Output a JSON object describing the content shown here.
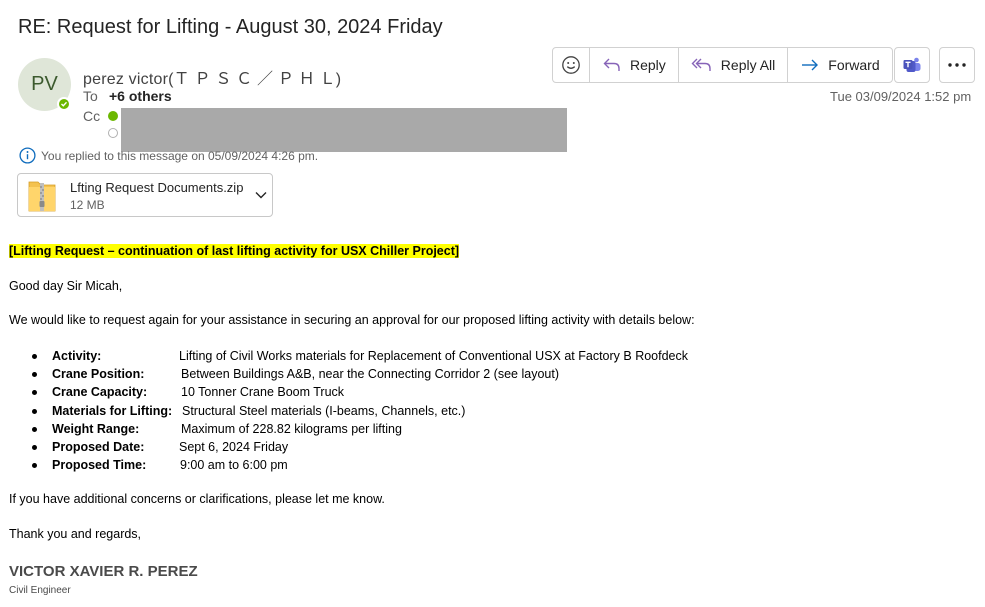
{
  "header": {
    "subject": "RE: Request for Lifting - August 30, 2024 Friday",
    "avatar_initials": "PV",
    "sender": "perez victor(Ｔ Ｐ Ｓ Ｃ ／ Ｐ Ｈ Ｌ)",
    "to_label": "To",
    "to_value": "+6 others",
    "cc_label": "Cc",
    "date": "Tue 03/09/2024 1:52 pm",
    "replied_notice": "You replied to this message on 05/09/2024 4:26 pm."
  },
  "toolbar": {
    "reply": "Reply",
    "reply_all": "Reply All",
    "forward": "Forward"
  },
  "attachment": {
    "name": "Lfting Request Documents.zip",
    "size": "12 MB"
  },
  "body": {
    "heading": "[Lifting Request – continuation of last lifting activity for USX Chiller Project]",
    "greeting": "Good day Sir Micah,",
    "intro": "We would like to request again for your assistance in securing an approval for our proposed lifting activity with details below:",
    "details": [
      {
        "label": "Activity:",
        "value": "Lifting of Civil Works materials for Replacement of Conventional USX at Factory B Roofdeck"
      },
      {
        "label": "Crane Position:",
        "value": "Between Buildings A&B, near the Connecting Corridor 2 (see layout)"
      },
      {
        "label": "Crane Capacity:",
        "value": "10 Tonner Crane Boom Truck"
      },
      {
        "label": "Materials for Lifting:",
        "value": "Structural Steel materials (I-beams, Channels, etc.)"
      },
      {
        "label": "Weight Range:",
        "value": "Maximum of 228.82 kilograms per lifting"
      },
      {
        "label": "Proposed Date:",
        "value": "Sept 6, 2024 Friday"
      },
      {
        "label": "Proposed Time:",
        "value": "9:00 am to 6:00 pm"
      }
    ],
    "closing_note": "If you have additional concerns or clarifications, please let me know.",
    "thanks": "Thank you and regards,",
    "signature_name": "VICTOR XAVIER R. PEREZ",
    "signature_title": "Civil Engineer"
  },
  "colors": {
    "presence": "#6bb700",
    "highlight": "#ffff00",
    "accent": "#0f6cbd",
    "teams": "#5059c9"
  }
}
